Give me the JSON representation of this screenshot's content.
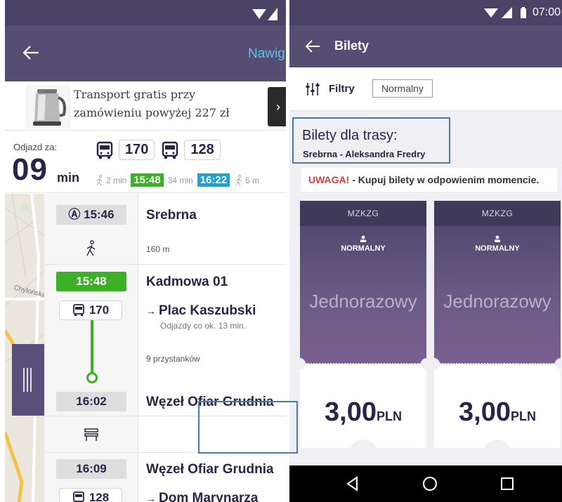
{
  "left": {
    "appbar": {
      "nav_label": "Nawig"
    },
    "ad": {
      "text": "Transport gratis przy zamówieniu powyżej 227 zł",
      "button_label": "›"
    },
    "departure": {
      "label": "Odjazd za:",
      "minutes": "09",
      "unit": "min",
      "lines": [
        "170",
        "128"
      ],
      "times": [
        {
          "walk": "2 min",
          "time": "15:48",
          "color": "#3cb026"
        },
        {
          "walk": "34 min",
          "time": "16:22",
          "color": "#1ea1d3"
        },
        {
          "walk": "5 m"
        }
      ]
    },
    "timeline": {
      "start_time": "Ⓐ 15:46",
      "start_stop": "Srebrna",
      "walk_distance": "160 m",
      "board_time": "15:48",
      "board_stop": "Kadmowa 01",
      "line1": "170",
      "direction1": "Plac Kaszubski",
      "frequency1": "Odjazdy co ok. 13 min.",
      "stops_count": "9 przystanków",
      "arrive_time": "16:02",
      "arrive_stop": "Węzeł Ofiar Grudnia",
      "transfer_time": "16:09",
      "transfer_stop": "Węzeł Ofiar Grudnia",
      "line2": "128",
      "direction2": "Dom Marynarza"
    },
    "map": {
      "street_label": "Chylońska"
    }
  },
  "right": {
    "status": {
      "time": "07:00"
    },
    "appbar": {
      "title": "Bilety"
    },
    "filters": {
      "label": "Filtry",
      "chip": "Normalny"
    },
    "route": {
      "title": "Bilety dla trasy:",
      "subtitle": "Srebrna - Aleksandra Fredry"
    },
    "warning": {
      "prefix": "UWAGA!",
      "text": " - Kupuj bilety w odpowienim momencie."
    },
    "tickets": [
      {
        "operator": "MZKZG",
        "type": "NORMALNY",
        "name": "Jednorazowy",
        "amount": "3,00",
        "currency": "PLN"
      },
      {
        "operator": "MZKZG",
        "type": "NORMALNY",
        "name": "Jednorazowy",
        "amount": "3,00",
        "currency": "PLN"
      }
    ]
  },
  "colors": {
    "header": "#554d72",
    "status": "#4a4366",
    "green": "#3cb026",
    "blue": "#1ea1d3",
    "dark_text": "#2a2448",
    "warning_red": "#e03a3a"
  }
}
